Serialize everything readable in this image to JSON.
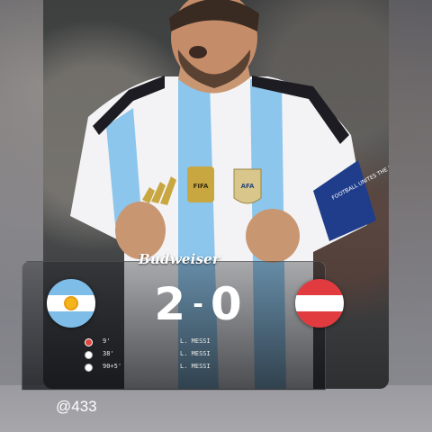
{
  "post": {
    "handle": "@433"
  },
  "graphic": {
    "sponsor": "Budweiser",
    "jersey": {
      "sleeve_text": "FOOTBALL UNITES THE WORLD",
      "badge_text": "FIFA",
      "crest_text": "AFA"
    },
    "match": {
      "home_team": "Argentina",
      "away_team": "Austria",
      "home_score": "2",
      "separator": "-",
      "away_score": "0"
    },
    "goals": [
      {
        "minute": "9'",
        "scorer": "L. MESSI",
        "icon": "red-card-icon"
      },
      {
        "minute": "38'",
        "scorer": "L. MESSI",
        "icon": "soccer-ball-icon"
      },
      {
        "minute": "90+5'",
        "scorer": "L. MESSI",
        "icon": "soccer-ball-icon"
      }
    ],
    "colors": {
      "argentina_sky": "#7dbde8",
      "austria_red": "#e23b3f",
      "captain_band": "#1f3d8a"
    }
  }
}
